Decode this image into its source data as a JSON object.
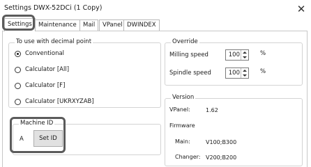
{
  "window": {
    "title": "Settings DWX-52DCi (1 Copy)",
    "close_glyph": "✕"
  },
  "tabs": [
    {
      "label": "Settings",
      "active": true
    },
    {
      "label": "Maintenance",
      "active": false
    },
    {
      "label": "Mail",
      "active": false
    },
    {
      "label": "VPanel",
      "active": false
    },
    {
      "label": "DWINDEX",
      "active": false
    }
  ],
  "decimal_group": {
    "label": "To use with decimal point",
    "options": [
      {
        "label": "Conventional",
        "checked": true
      },
      {
        "label": "Calculator [All]",
        "checked": false
      },
      {
        "label": "Calculator [F]",
        "checked": false
      },
      {
        "label": "Calculator [UKRXYZAB]",
        "checked": false
      }
    ]
  },
  "machine_id_group": {
    "label": "Machine ID",
    "value": "A",
    "button_label": "Set ID"
  },
  "override_group": {
    "label": "Override",
    "milling_speed_label": "Milling speed",
    "milling_speed_value": "100",
    "spindle_speed_label": "Spindle speed",
    "spindle_speed_value": "100",
    "unit": "%"
  },
  "version_group": {
    "label": "Version",
    "vpanel_label": "VPanel:",
    "vpanel_value": "1.62",
    "firmware_label": "Firmware",
    "main_label": "Main:",
    "main_value": "V100;B300",
    "changer_label": "Changer:",
    "changer_value": "V200;B200"
  }
}
